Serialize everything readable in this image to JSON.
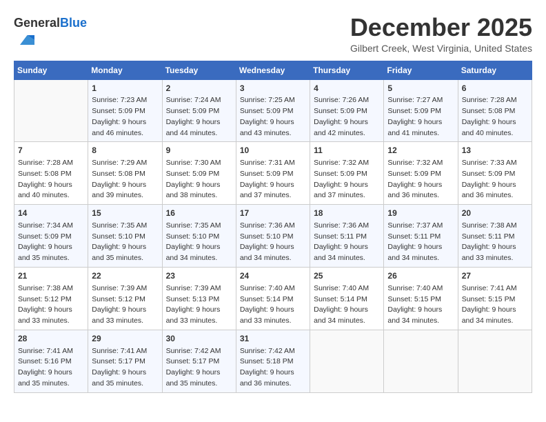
{
  "header": {
    "logo_general": "General",
    "logo_blue": "Blue",
    "month_title": "December 2025",
    "subtitle": "Gilbert Creek, West Virginia, United States"
  },
  "days_of_week": [
    "Sunday",
    "Monday",
    "Tuesday",
    "Wednesday",
    "Thursday",
    "Friday",
    "Saturday"
  ],
  "weeks": [
    [
      {
        "day": "",
        "info": ""
      },
      {
        "day": "1",
        "info": "Sunrise: 7:23 AM\nSunset: 5:09 PM\nDaylight: 9 hours\nand 46 minutes."
      },
      {
        "day": "2",
        "info": "Sunrise: 7:24 AM\nSunset: 5:09 PM\nDaylight: 9 hours\nand 44 minutes."
      },
      {
        "day": "3",
        "info": "Sunrise: 7:25 AM\nSunset: 5:09 PM\nDaylight: 9 hours\nand 43 minutes."
      },
      {
        "day": "4",
        "info": "Sunrise: 7:26 AM\nSunset: 5:09 PM\nDaylight: 9 hours\nand 42 minutes."
      },
      {
        "day": "5",
        "info": "Sunrise: 7:27 AM\nSunset: 5:09 PM\nDaylight: 9 hours\nand 41 minutes."
      },
      {
        "day": "6",
        "info": "Sunrise: 7:28 AM\nSunset: 5:08 PM\nDaylight: 9 hours\nand 40 minutes."
      }
    ],
    [
      {
        "day": "7",
        "info": "Sunrise: 7:28 AM\nSunset: 5:08 PM\nDaylight: 9 hours\nand 40 minutes."
      },
      {
        "day": "8",
        "info": "Sunrise: 7:29 AM\nSunset: 5:08 PM\nDaylight: 9 hours\nand 39 minutes."
      },
      {
        "day": "9",
        "info": "Sunrise: 7:30 AM\nSunset: 5:09 PM\nDaylight: 9 hours\nand 38 minutes."
      },
      {
        "day": "10",
        "info": "Sunrise: 7:31 AM\nSunset: 5:09 PM\nDaylight: 9 hours\nand 37 minutes."
      },
      {
        "day": "11",
        "info": "Sunrise: 7:32 AM\nSunset: 5:09 PM\nDaylight: 9 hours\nand 37 minutes."
      },
      {
        "day": "12",
        "info": "Sunrise: 7:32 AM\nSunset: 5:09 PM\nDaylight: 9 hours\nand 36 minutes."
      },
      {
        "day": "13",
        "info": "Sunrise: 7:33 AM\nSunset: 5:09 PM\nDaylight: 9 hours\nand 36 minutes."
      }
    ],
    [
      {
        "day": "14",
        "info": "Sunrise: 7:34 AM\nSunset: 5:09 PM\nDaylight: 9 hours\nand 35 minutes."
      },
      {
        "day": "15",
        "info": "Sunrise: 7:35 AM\nSunset: 5:10 PM\nDaylight: 9 hours\nand 35 minutes."
      },
      {
        "day": "16",
        "info": "Sunrise: 7:35 AM\nSunset: 5:10 PM\nDaylight: 9 hours\nand 34 minutes."
      },
      {
        "day": "17",
        "info": "Sunrise: 7:36 AM\nSunset: 5:10 PM\nDaylight: 9 hours\nand 34 minutes."
      },
      {
        "day": "18",
        "info": "Sunrise: 7:36 AM\nSunset: 5:11 PM\nDaylight: 9 hours\nand 34 minutes."
      },
      {
        "day": "19",
        "info": "Sunrise: 7:37 AM\nSunset: 5:11 PM\nDaylight: 9 hours\nand 34 minutes."
      },
      {
        "day": "20",
        "info": "Sunrise: 7:38 AM\nSunset: 5:11 PM\nDaylight: 9 hours\nand 33 minutes."
      }
    ],
    [
      {
        "day": "21",
        "info": "Sunrise: 7:38 AM\nSunset: 5:12 PM\nDaylight: 9 hours\nand 33 minutes."
      },
      {
        "day": "22",
        "info": "Sunrise: 7:39 AM\nSunset: 5:12 PM\nDaylight: 9 hours\nand 33 minutes."
      },
      {
        "day": "23",
        "info": "Sunrise: 7:39 AM\nSunset: 5:13 PM\nDaylight: 9 hours\nand 33 minutes."
      },
      {
        "day": "24",
        "info": "Sunrise: 7:40 AM\nSunset: 5:14 PM\nDaylight: 9 hours\nand 33 minutes."
      },
      {
        "day": "25",
        "info": "Sunrise: 7:40 AM\nSunset: 5:14 PM\nDaylight: 9 hours\nand 34 minutes."
      },
      {
        "day": "26",
        "info": "Sunrise: 7:40 AM\nSunset: 5:15 PM\nDaylight: 9 hours\nand 34 minutes."
      },
      {
        "day": "27",
        "info": "Sunrise: 7:41 AM\nSunset: 5:15 PM\nDaylight: 9 hours\nand 34 minutes."
      }
    ],
    [
      {
        "day": "28",
        "info": "Sunrise: 7:41 AM\nSunset: 5:16 PM\nDaylight: 9 hours\nand 35 minutes."
      },
      {
        "day": "29",
        "info": "Sunrise: 7:41 AM\nSunset: 5:17 PM\nDaylight: 9 hours\nand 35 minutes."
      },
      {
        "day": "30",
        "info": "Sunrise: 7:42 AM\nSunset: 5:17 PM\nDaylight: 9 hours\nand 35 minutes."
      },
      {
        "day": "31",
        "info": "Sunrise: 7:42 AM\nSunset: 5:18 PM\nDaylight: 9 hours\nand 36 minutes."
      },
      {
        "day": "",
        "info": ""
      },
      {
        "day": "",
        "info": ""
      },
      {
        "day": "",
        "info": ""
      }
    ]
  ]
}
